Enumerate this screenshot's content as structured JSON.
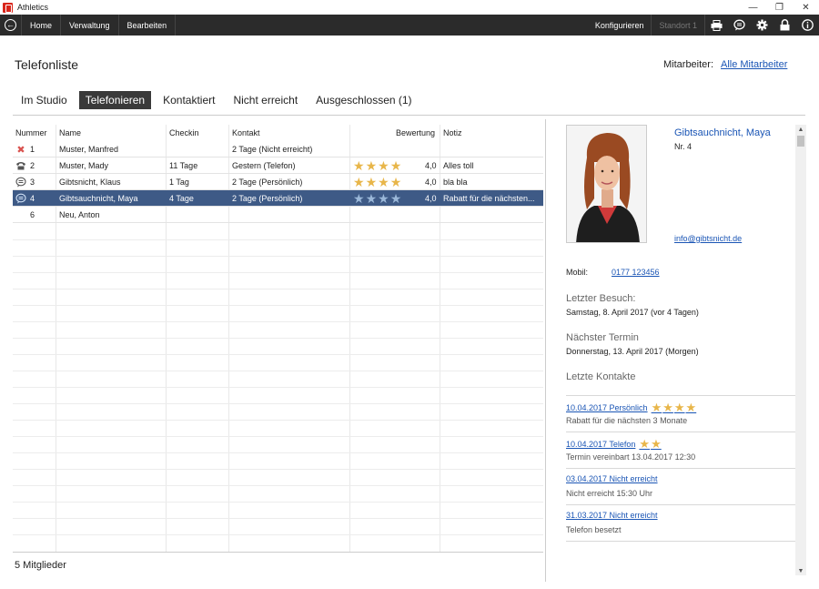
{
  "window": {
    "title": "Athletics",
    "minimize": "—",
    "restore": "❐",
    "close": "✕"
  },
  "toolbar": {
    "back": "←",
    "items": [
      "Home",
      "Verwaltung",
      "Bearbeiten"
    ],
    "configure": "Konfigurieren",
    "location": "Standort 1",
    "icons": [
      "printer-icon",
      "chat-icon",
      "gear-icon",
      "lock-icon",
      "info-icon"
    ]
  },
  "page": {
    "title": "Telefonliste",
    "staff_label": "Mitarbeiter:",
    "staff_value": "Alle Mitarbeiter"
  },
  "tabs": [
    {
      "label": "Im Studio",
      "active": false
    },
    {
      "label": "Telefonieren",
      "active": true
    },
    {
      "label": "Kontaktiert",
      "active": false
    },
    {
      "label": "Nicht erreicht",
      "active": false
    },
    {
      "label": "Ausgeschlossen (1)",
      "active": false
    }
  ],
  "table": {
    "headers": {
      "nummer": "Nummer",
      "name": "Name",
      "checkin": "Checkin",
      "kontakt": "Kontakt",
      "bewertung": "Bewertung",
      "notiz": "Notiz"
    },
    "rows": [
      {
        "icon": "x-icon",
        "nummer": "1",
        "name": "Muster, Manfred",
        "checkin": "",
        "kontakt": "2 Tage  (Nicht erreicht)",
        "stars": 0,
        "rating": "",
        "notiz": "",
        "selected": false
      },
      {
        "icon": "phone-icon",
        "nummer": "2",
        "name": "Muster, Mady",
        "checkin": "11 Tage",
        "kontakt": "Gestern  (Telefon)",
        "stars": 4,
        "rating": "4,0",
        "notiz": "Alles toll",
        "selected": false
      },
      {
        "icon": "chat-icon",
        "nummer": "3",
        "name": "Gibtsnicht, Klaus",
        "checkin": "1 Tag",
        "kontakt": "2 Tage  (Persönlich)",
        "stars": 4,
        "rating": "4,0",
        "notiz": "bla bla",
        "selected": false
      },
      {
        "icon": "chat-icon",
        "nummer": "4",
        "name": "Gibtsauchnicht, Maya",
        "checkin": "4 Tage",
        "kontakt": "2 Tage  (Persönlich)",
        "stars": 4,
        "rating": "4,0",
        "notiz": "Rabatt für die nächsten...",
        "selected": true
      },
      {
        "icon": "",
        "nummer": "6",
        "name": "Neu, Anton",
        "checkin": "",
        "kontakt": "",
        "stars": 0,
        "rating": "",
        "notiz": "",
        "selected": false
      }
    ],
    "footer": "5 Mitglieder"
  },
  "detail": {
    "name": "Gibtsauchnicht, Maya",
    "nr": "Nr. 4",
    "email": "info@gibtsnicht.de",
    "mobil_label": "Mobil:",
    "mobil_value": "0177 123456",
    "last_visit_title": "Letzter Besuch:",
    "last_visit_value": "Samstag, 8. April 2017 (vor 4 Tagen)",
    "next_appt_title": "Nächster Termin",
    "next_appt_value": "Donnerstag, 13. April 2017 (Morgen)",
    "contacts_title": "Letzte Kontakte",
    "contacts": [
      {
        "head": "10.04.2017 Persönlich ",
        "stars": 4,
        "note": "Rabatt für die nächsten 3 Monate"
      },
      {
        "head": "10.04.2017 Telefon ",
        "stars": 2,
        "note": "Termin vereinbart 13.04.2017 12:30"
      },
      {
        "head": "03.04.2017 Nicht erreicht ",
        "stars": 0,
        "note": "Nicht erreicht 15:30 Uhr"
      },
      {
        "head": "31.03.2017 Nicht erreicht ",
        "stars": 0,
        "note": "Telefon besetzt"
      }
    ]
  },
  "colors": {
    "accent": "#1a55b5",
    "selected_row": "#3e5a86",
    "star": "#e8b64a",
    "toolbar": "#2b2b2b"
  }
}
